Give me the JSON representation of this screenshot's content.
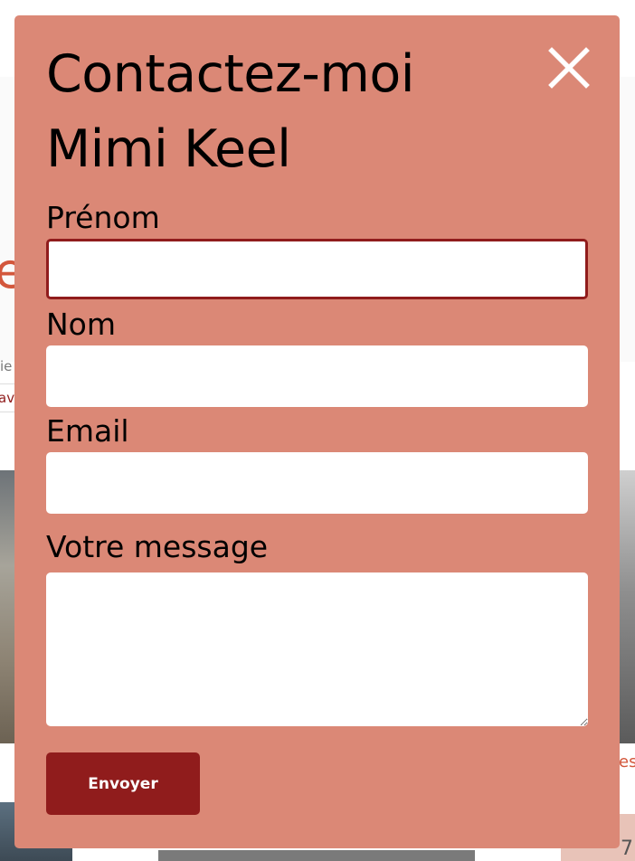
{
  "modal": {
    "title_line1": "Contactez-moi",
    "title_line2": "Mimi Keel",
    "close_icon": "close-icon",
    "background_color": "#DB8876",
    "accent_color": "#901C1C"
  },
  "form": {
    "first_name_label": "Prénom",
    "first_name_value": "",
    "last_name_label": "Nom",
    "last_name_value": "",
    "email_label": "Email",
    "email_value": "",
    "message_label": "Votre message",
    "message_value": "",
    "submit_label": "Envoyer"
  },
  "background": {
    "title_fragment": "e",
    "text_fragment": "ie",
    "tag_fragment": "av",
    "caption_fragment": "es",
    "likes_fragment": "7"
  }
}
